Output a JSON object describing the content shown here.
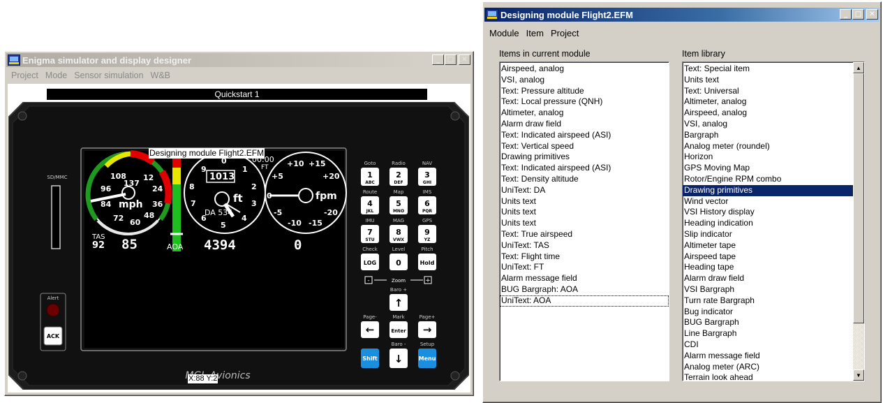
{
  "simulator": {
    "title": "Enigma simulator and display designer",
    "menu": [
      "Project",
      "Mode",
      "Sensor simulation",
      "W&B"
    ],
    "quickstart_label": "Quickstart 1",
    "module_label": "Designing module Flight2.EFM",
    "coords": "X:88 Y:2",
    "brand": "MGL Avionics",
    "slot_label": "SD/MMC",
    "alert_label": "Alert",
    "ack_label": "ACK",
    "airspeed": {
      "tas_label": "TAS",
      "tas_value": "92",
      "value": "85",
      "unit": "mph",
      "ticks": [
        "108",
        "137",
        "12",
        "24",
        "36",
        "48",
        "60",
        "72",
        "84",
        "96"
      ]
    },
    "aoa_label": "AOA",
    "altimeter": {
      "baro": "1013",
      "unit": "ft",
      "da": "DA 534",
      "value": "4394",
      "digits": [
        "0",
        "1",
        "2",
        "3",
        "4",
        "5",
        "6",
        "7",
        "8",
        "9"
      ]
    },
    "timer": "00:00",
    "timer_unit": "FT",
    "vsi": {
      "unit": "fpm",
      "value": "0",
      "ticks": [
        "+10",
        "+15",
        "+5",
        "+20",
        "0",
        "-5",
        "-20",
        "-10",
        "-15"
      ]
    },
    "keypad": {
      "top_labels": [
        "Goto",
        "Radio",
        "NAV",
        "Route",
        "Map",
        "IMS",
        "IMU",
        "MAG",
        "GPS"
      ],
      "keys": [
        {
          "num": "1",
          "sub": "ABC"
        },
        {
          "num": "2",
          "sub": "DEF"
        },
        {
          "num": "3",
          "sub": "GHI"
        },
        {
          "num": "4",
          "sub": "JKL"
        },
        {
          "num": "5",
          "sub": "MNO"
        },
        {
          "num": "6",
          "sub": "PQR"
        },
        {
          "num": "7",
          "sub": "STU"
        },
        {
          "num": "8",
          "sub": "VWX"
        },
        {
          "num": "9",
          "sub": "YZ"
        }
      ],
      "row4_labels": [
        "Check",
        "Level",
        "Pitch"
      ],
      "row4_keys": [
        "LOG",
        "0",
        "Hold"
      ],
      "zoom_label": "Zoom",
      "zoom_minus": "-",
      "zoom_plus": "+",
      "baro_plus": "Baro +",
      "baro_minus": "Baro -",
      "page_minus": "Page-",
      "mark": "Mark",
      "page_plus": "Page+",
      "enter": "Enter",
      "setup": "Setup",
      "shift": "Shift",
      "menu": "Menu"
    }
  },
  "designer": {
    "title": "Designing module Flight2.EFM",
    "menu": [
      "Module",
      "Item",
      "Project"
    ],
    "items_label": "Items in current module",
    "library_label": "Item library",
    "items": [
      "Airspeed, analog",
      "VSI, analog",
      "Text: Pressure altitude",
      "Text: Local pressure (QNH)",
      "Altimeter, analog",
      "Alarm draw field",
      "Text: Indicated airspeed (ASI)",
      "Text: Vertical speed",
      "Drawing primitives",
      "Text: Indicated airspeed (ASI)",
      "Text: Density altitude",
      "UniText: DA",
      "Units text",
      "Units text",
      "Units text",
      "Text: True airspeed",
      "UniText: TAS",
      "Text: Flight time",
      "UniText: FT",
      "Alarm message field",
      "BUG Bargraph: AOA",
      "UniText: AOA"
    ],
    "library": [
      "Text: Special item",
      "Units text",
      "Text: Universal",
      "Altimeter, analog",
      "Airspeed, analog",
      "VSI, analog",
      "Bargraph",
      "Analog meter (roundel)",
      "Horizon",
      "GPS Moving Map",
      "Rotor/Engine RPM combo",
      "Drawing primitives",
      "Wind vector",
      "VSI History display",
      "Heading indication",
      "Slip indicator",
      "Altimeter tape",
      "Airspeed tape",
      "Heading tape",
      "Alarm draw field",
      "VSI Bargraph",
      "Turn rate Bargraph",
      "Bug indicator",
      "BUG Bargraph",
      "Line Bargraph",
      "CDI",
      "Alarm message field",
      "Analog meter (ARC)",
      "Terrain look ahead"
    ],
    "selected_library": "Drawing primitives",
    "focused_item": "UniText: AOA"
  },
  "icons": [
    "minimize-icon",
    "maximize-icon",
    "close-icon",
    "app-icon",
    "scroll-up-icon",
    "scroll-down-icon"
  ]
}
